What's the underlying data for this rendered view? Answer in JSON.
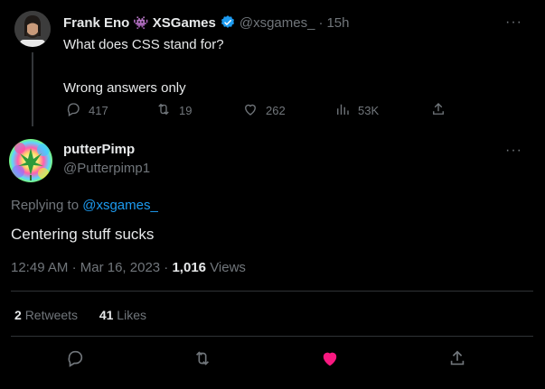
{
  "parent_tweet": {
    "display_name": "Frank Eno",
    "emoji": "👾",
    "brand_name": "XSGames",
    "handle": "@xsgames_",
    "separator": "·",
    "time": "15h",
    "line1": "What does CSS stand for?",
    "line2": "Wrong answers only",
    "replies": "417",
    "retweets": "19",
    "likes": "262",
    "views": "53K"
  },
  "reply_tweet": {
    "display_name": "putterPimp",
    "handle": "@Putterpimp1",
    "replying_prefix": "Replying to",
    "replying_handle": "@xsgames_",
    "text": "Centering stuff sucks",
    "time": "12:49 AM",
    "date_sep": "·",
    "date": "Mar 16, 2023",
    "views_sep": "·",
    "views_count": "1,016",
    "views_label": "Views",
    "retweets_count": "2",
    "retweets_label": "Retweets",
    "likes_count": "41",
    "likes_label": "Likes"
  },
  "more_glyph": "···",
  "colors": {
    "background": "#000000",
    "text": "#e7e9ea",
    "muted": "#71767b",
    "link": "#1d9bf0",
    "verified": "#1d9bf0",
    "like_active": "#f91880",
    "divider": "#2f3336"
  },
  "icons": [
    "reply-icon",
    "retweet-icon",
    "like-icon",
    "views-icon",
    "share-icon",
    "verified-icon",
    "more-icon"
  ]
}
